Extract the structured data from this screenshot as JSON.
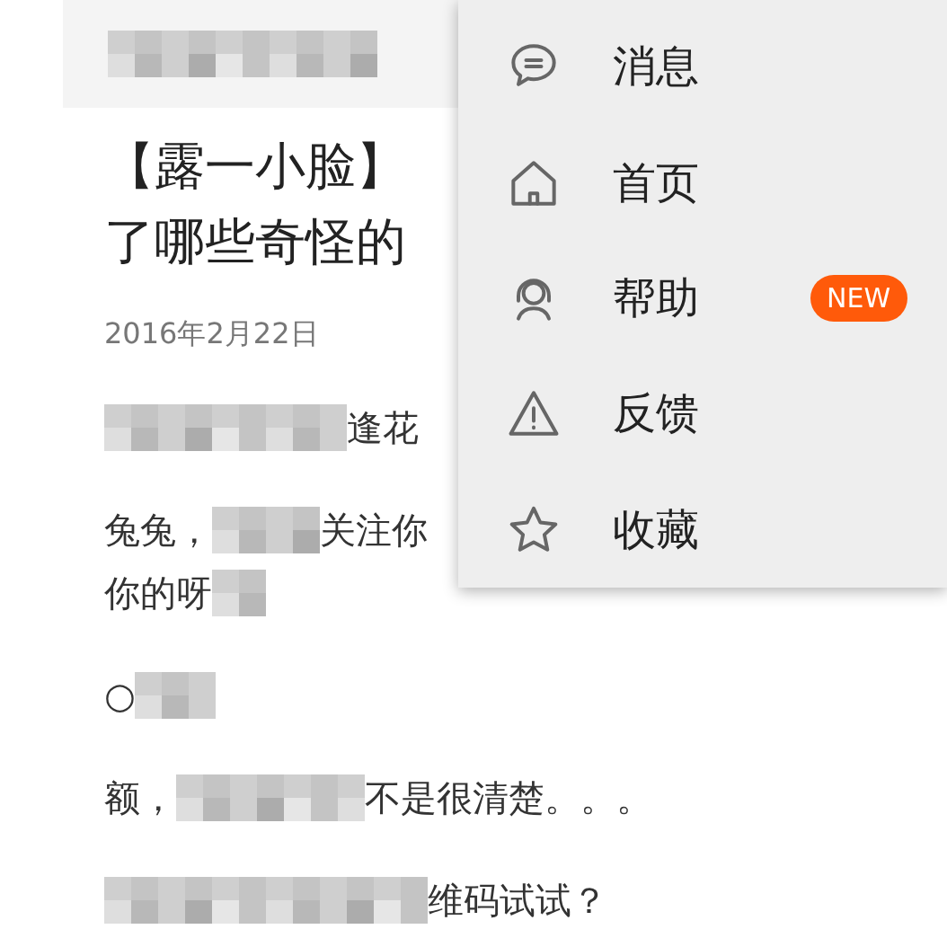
{
  "article": {
    "title_lines": [
      "【露一小脸】",
      "了哪些奇怪的"
    ],
    "date": "2016年2月22日",
    "paragraphs": [
      {
        "lines": [
          [
            {
              "kind": "mosaic"
            },
            {
              "kind": "text",
              "text": "逢花"
            }
          ]
        ]
      },
      {
        "lines": [
          [
            {
              "kind": "text",
              "text": "兔兔，"
            },
            {
              "kind": "mosaic"
            },
            {
              "kind": "text",
              "text": "关注你"
            }
          ],
          [
            {
              "kind": "text",
              "text": "你的呀"
            },
            {
              "kind": "mosaic"
            }
          ]
        ]
      },
      {
        "lines": [
          [
            {
              "kind": "text",
              "text": "○"
            },
            {
              "kind": "mosaic"
            }
          ]
        ]
      },
      {
        "lines": [
          [
            {
              "kind": "text",
              "text": "额，"
            },
            {
              "kind": "mosaic"
            },
            {
              "kind": "text",
              "text": "不是很清楚。。。"
            }
          ]
        ]
      },
      {
        "lines": [
          [
            {
              "kind": "mosaic"
            },
            {
              "kind": "text",
              "text": "维码试试？"
            }
          ]
        ]
      }
    ]
  },
  "menu": {
    "items": [
      {
        "kind": "message",
        "label": "消息"
      },
      {
        "kind": "home",
        "label": "首页"
      },
      {
        "kind": "help",
        "label": "帮助",
        "badge": "NEW"
      },
      {
        "kind": "warning",
        "label": "反馈"
      },
      {
        "kind": "star",
        "label": "收藏"
      }
    ]
  }
}
